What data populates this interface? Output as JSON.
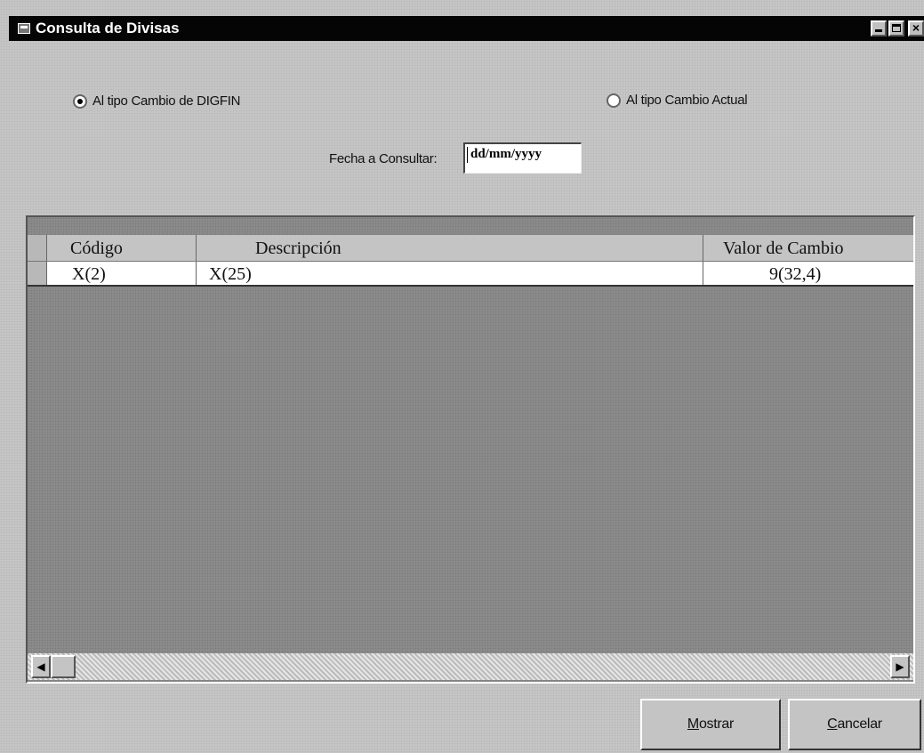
{
  "window": {
    "title": "Consulta de Divisas",
    "icon": "app-icon",
    "controls": {
      "minimize": "minimize-icon",
      "maximize": "maximize-icon",
      "close": "×"
    }
  },
  "options": {
    "radio1_label": "Al tipo Cambio de DIGFIN",
    "radio1_selected": true,
    "radio2_label": "Al tipo Cambio Actual",
    "radio2_selected": false
  },
  "fecha": {
    "label": "Fecha a Consultar:",
    "value": "dd/mm/yyyy"
  },
  "grid": {
    "headers": {
      "codigo": "Código",
      "descripcion": "Descripción",
      "valor": "Valor de Cambio"
    },
    "rows": [
      {
        "codigo": "X(2)",
        "descripcion": "X(25)",
        "valor": "9(32,4)"
      }
    ],
    "scroll": {
      "left": "◀",
      "right": "▶"
    }
  },
  "buttons": {
    "mostrar": "Mostrar",
    "mostrar_accesskey": "M",
    "cancelar": "Cancelar",
    "cancelar_accesskey": "C"
  }
}
